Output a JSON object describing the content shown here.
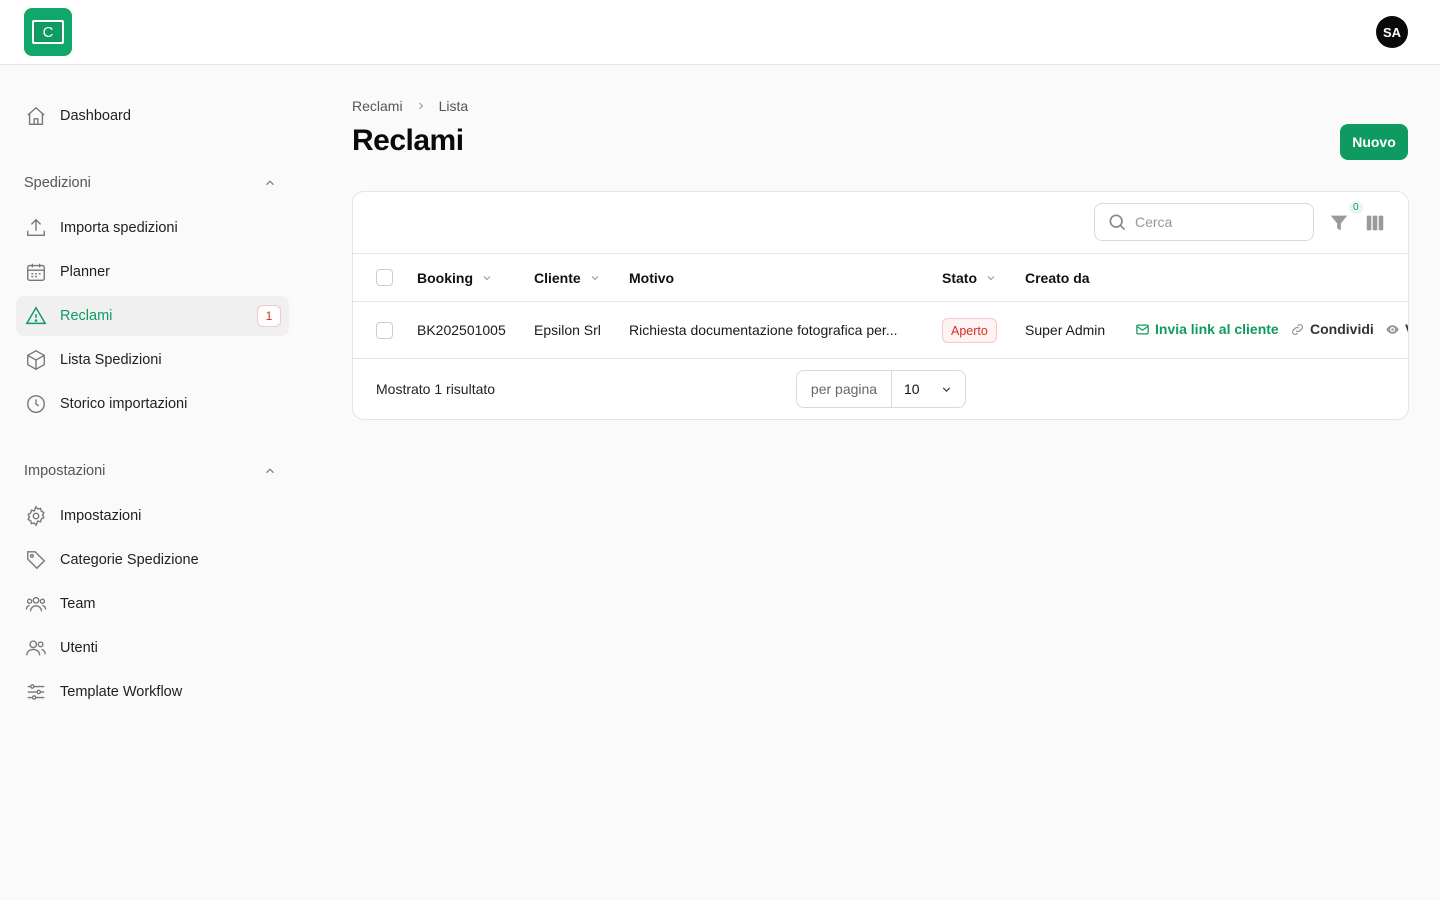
{
  "header": {
    "logo_letter": "C",
    "avatar_initials": "SA"
  },
  "sidebar": {
    "dashboard": "Dashboard",
    "group_shipments": "Spedizioni",
    "group_settings": "Impostazioni",
    "items": [
      {
        "label": "Importa spedizioni",
        "icon": "upload-icon"
      },
      {
        "label": "Planner",
        "icon": "calendar-icon"
      },
      {
        "label": "Reclami",
        "icon": "warning-icon",
        "badge": "1",
        "active": true
      },
      {
        "label": "Lista Spedizioni",
        "icon": "box-icon"
      },
      {
        "label": "Storico importazioni",
        "icon": "clock-icon"
      }
    ],
    "settings_items": [
      {
        "label": "Impostazioni",
        "icon": "gear-icon"
      },
      {
        "label": "Categorie Spedizione",
        "icon": "tag-icon"
      },
      {
        "label": "Team",
        "icon": "team-icon"
      },
      {
        "label": "Utenti",
        "icon": "users-icon"
      },
      {
        "label": "Template Workflow",
        "icon": "sliders-icon"
      }
    ]
  },
  "breadcrumb": {
    "root": "Reclami",
    "current": "Lista"
  },
  "page": {
    "title": "Reclami",
    "new_button": "Nuovo"
  },
  "toolbar": {
    "search_placeholder": "Cerca",
    "filter_count": "0"
  },
  "table": {
    "columns": {
      "booking": "Booking",
      "client": "Cliente",
      "reason": "Motivo",
      "status": "Stato",
      "created_by": "Creato da"
    },
    "rows": [
      {
        "booking": "BK202501005",
        "client": "Epsilon Srl",
        "reason": "Richiesta documentazione fotografica per...",
        "status": "Aperto",
        "created_by": "Super Admin",
        "action_send": "Invia link al cliente",
        "action_share": "Condividi",
        "action_view": "V"
      }
    ]
  },
  "footer": {
    "results": "Mostrato 1 risultato",
    "per_page_label": "per pagina",
    "per_page_value": "10"
  },
  "colors": {
    "accent": "#0f9a62",
    "danger": "#d92d20"
  }
}
